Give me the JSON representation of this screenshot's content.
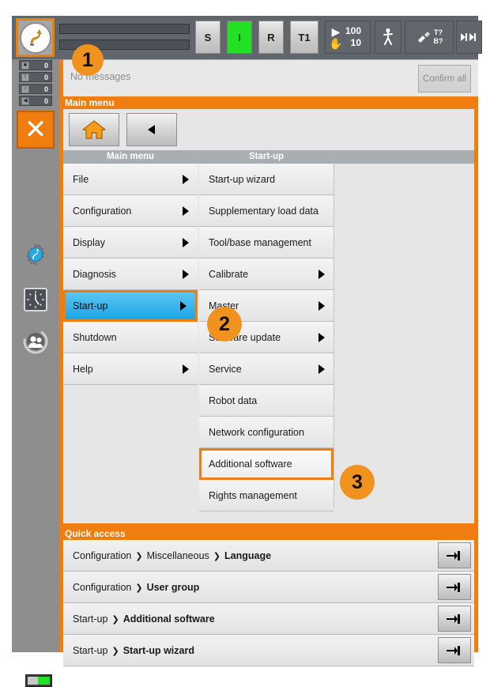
{
  "toolbar": {
    "robot_icon": "kuka-robot-icon",
    "buttons": [
      {
        "label": "S",
        "name": "submit-interpreter-button",
        "state": "normal"
      },
      {
        "label": "I",
        "name": "drives-ready-button",
        "state": "green"
      },
      {
        "label": "R",
        "name": "robot-interpreter-button",
        "state": "normal"
      },
      {
        "label": "T1",
        "name": "operating-mode-button",
        "state": "normal"
      }
    ],
    "override": {
      "program_value": "100",
      "jog_value": "10",
      "program_icon": "play-icon",
      "jog_icon": "hand-icon"
    },
    "walk_icon": "walk-figure-icon",
    "tool_icon": "tool-gripper-icon",
    "tool_label_top": "T?",
    "tool_label_bottom": "B?",
    "increment_icon": "increment-step-icon"
  },
  "messages": {
    "text": "No messages",
    "confirm_label": "Confirm all"
  },
  "sidebar": {
    "counters": [
      {
        "icon": "ack-message-icon",
        "count": "0"
      },
      {
        "icon": "warning-message-icon",
        "count": "0"
      },
      {
        "icon": "info-message-icon",
        "count": "0"
      },
      {
        "icon": "wait-message-icon",
        "count": "0"
      }
    ],
    "close_icon": "close-x-icon",
    "icons": [
      {
        "name": "robot-settings-icon"
      },
      {
        "name": "clock-icon"
      },
      {
        "name": "user-group-icon"
      }
    ],
    "battery_icon": "battery-icon"
  },
  "main_menu": {
    "panel_title": "Main menu",
    "home_icon": "home-icon",
    "back_icon": "back-arrow-icon",
    "column_headers": [
      "Main menu",
      "Start-up"
    ],
    "column1": [
      {
        "label": "File",
        "submenu": true,
        "state": "normal"
      },
      {
        "label": "Configuration",
        "submenu": true,
        "state": "normal"
      },
      {
        "label": "Display",
        "submenu": true,
        "state": "normal"
      },
      {
        "label": "Diagnosis",
        "submenu": true,
        "state": "normal"
      },
      {
        "label": "Start-up",
        "submenu": true,
        "state": "selected"
      },
      {
        "label": "Shutdown",
        "submenu": false,
        "state": "normal"
      },
      {
        "label": "Help",
        "submenu": true,
        "state": "normal"
      }
    ],
    "column2": [
      {
        "label": "Start-up wizard",
        "submenu": false,
        "state": "normal"
      },
      {
        "label": "Supplementary load data",
        "submenu": false,
        "state": "normal"
      },
      {
        "label": "Tool/base management",
        "submenu": false,
        "state": "normal"
      },
      {
        "label": "Calibrate",
        "submenu": true,
        "state": "normal"
      },
      {
        "label": "Master",
        "submenu": true,
        "state": "normal"
      },
      {
        "label": "Software update",
        "submenu": true,
        "state": "normal"
      },
      {
        "label": "Service",
        "submenu": true,
        "state": "normal"
      },
      {
        "label": "Robot data",
        "submenu": false,
        "state": "normal"
      },
      {
        "label": "Network configuration",
        "submenu": false,
        "state": "normal"
      },
      {
        "label": "Additional software",
        "submenu": false,
        "state": "highlighted"
      },
      {
        "label": "Rights management",
        "submenu": false,
        "state": "normal"
      }
    ]
  },
  "quick_access": {
    "panel_title": "Quick access",
    "separator": "❯",
    "pin_icon": "pin-icon",
    "rows": [
      {
        "path": [
          "Configuration",
          "Miscellaneous"
        ],
        "last": "Language"
      },
      {
        "path": [
          "Configuration"
        ],
        "last": "User group"
      },
      {
        "path": [
          "Start-up"
        ],
        "last": "Additional software"
      },
      {
        "path": [
          "Start-up"
        ],
        "last": "Start-up wizard"
      }
    ]
  },
  "callouts": [
    {
      "number": "1"
    },
    {
      "number": "2"
    },
    {
      "number": "3"
    }
  ],
  "colors": {
    "accent_orange": "#f07d10",
    "selection_blue": "#1aa6e8",
    "status_green": "#22e023",
    "toolbar_dark": "#60666b"
  }
}
